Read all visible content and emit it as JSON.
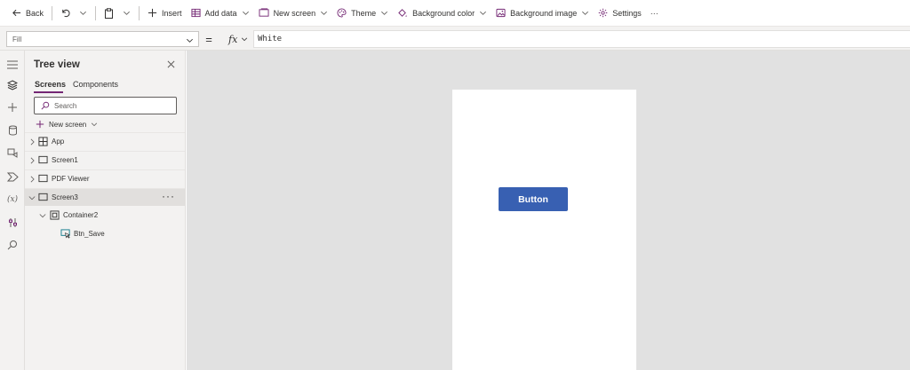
{
  "toolbar": {
    "back_label": "Back",
    "insert_label": "Insert",
    "add_data_label": "Add data",
    "new_screen_label": "New screen",
    "theme_label": "Theme",
    "background_color_label": "Background color",
    "background_image_label": "Background image",
    "settings_label": "Settings",
    "more_label": "···"
  },
  "formula_bar": {
    "property": "Fill",
    "equals": "=",
    "fx_label": "fx",
    "formula": "White"
  },
  "rail": {
    "variables_label": "(x)"
  },
  "tree_view": {
    "title": "Tree view",
    "tabs": [
      {
        "label": "Screens",
        "active": true
      },
      {
        "label": "Components",
        "active": false
      }
    ],
    "search_placeholder": "Search",
    "new_screen_label": "New screen",
    "items": [
      {
        "label": "App",
        "icon": "app-icon"
      },
      {
        "label": "Screen1",
        "icon": "screen-icon"
      },
      {
        "label": "PDF Viewer",
        "icon": "screen-icon"
      },
      {
        "label": "Screen3",
        "icon": "screen-icon",
        "selected": true,
        "more": "···"
      },
      {
        "label": "Container2",
        "icon": "container-icon"
      },
      {
        "label": "Btn_Save",
        "icon": "button-control-icon"
      }
    ]
  },
  "canvas": {
    "button_label": "Button",
    "button_color": "#3860b2",
    "canvas_background": "#e1e1e1",
    "accent_color": "#742774"
  }
}
